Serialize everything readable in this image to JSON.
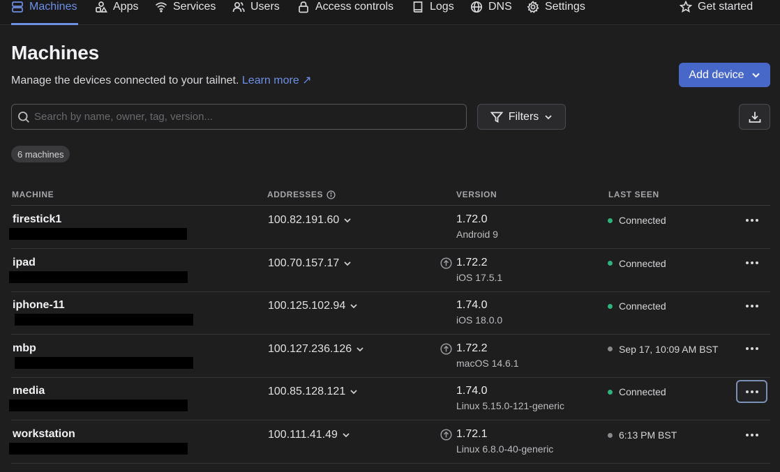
{
  "nav": {
    "items": [
      {
        "label": "Machines",
        "icon": "server-icon",
        "active": true
      },
      {
        "label": "Apps",
        "icon": "apps-icon"
      },
      {
        "label": "Services",
        "icon": "wifi-icon"
      },
      {
        "label": "Users",
        "icon": "users-icon"
      },
      {
        "label": "Access controls",
        "icon": "lock-icon"
      },
      {
        "label": "Logs",
        "icon": "book-icon"
      },
      {
        "label": "DNS",
        "icon": "globe-icon"
      },
      {
        "label": "Settings",
        "icon": "gear-icon"
      }
    ],
    "get_started": "Get started"
  },
  "header": {
    "title": "Machines",
    "subtitle": "Manage the devices connected to your tailnet.",
    "learn_more": "Learn more ↗",
    "add_device": "Add device"
  },
  "toolbar": {
    "search_placeholder": "Search by name, owner, tag, version...",
    "filters_label": "Filters"
  },
  "count_badge": "6 machines",
  "table": {
    "columns": {
      "machine": "MACHINE",
      "addresses": "ADDRESSES",
      "version": "VERSION",
      "last_seen": "LAST SEEN"
    },
    "rows": [
      {
        "name": "firestick1",
        "address": "100.82.191.60",
        "version": "1.72.0",
        "os": "Android 9",
        "update": false,
        "last_seen": "Connected",
        "online": true
      },
      {
        "name": "ipad",
        "address": "100.70.157.17",
        "version": "1.72.2",
        "os": "iOS 17.5.1",
        "update": true,
        "last_seen": "Connected",
        "online": true
      },
      {
        "name": "iphone-11",
        "address": "100.125.102.94",
        "version": "1.74.0",
        "os": "iOS 18.0.0",
        "update": false,
        "last_seen": "Connected",
        "online": true
      },
      {
        "name": "mbp",
        "address": "100.127.236.126",
        "version": "1.72.2",
        "os": "macOS 14.6.1",
        "update": true,
        "last_seen": "Sep 17, 10:09 AM BST",
        "online": false
      },
      {
        "name": "media",
        "address": "100.85.128.121",
        "version": "1.74.0",
        "os": "Linux 5.15.0-121-generic",
        "update": false,
        "last_seen": "Connected",
        "online": true,
        "focused": true
      },
      {
        "name": "workstation",
        "address": "100.111.41.49",
        "version": "1.72.1",
        "os": "Linux 6.8.0-40-generic",
        "update": true,
        "last_seen": "6:13 PM BST",
        "online": false
      }
    ]
  },
  "colors": {
    "accent": "#6d8fe6",
    "primary_button": "#4868c9",
    "online": "#2fb37a",
    "offline": "#8a8a8e"
  }
}
